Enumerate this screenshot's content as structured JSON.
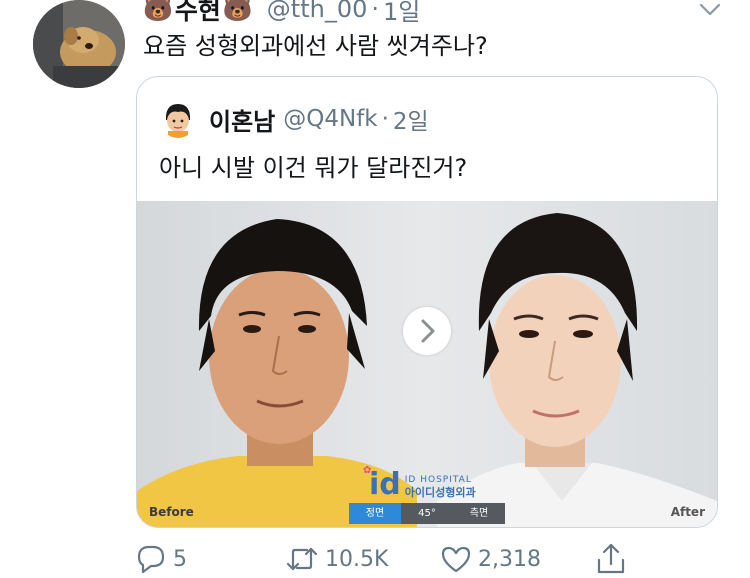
{
  "tweet": {
    "emoji_left": "🐻",
    "display_name": "수현",
    "emoji_right": "🐻",
    "handle": "@tth_00",
    "separator": "·",
    "time": "1일",
    "text": "요즘 성형외과에선 사람 씻겨주나?"
  },
  "quoted_tweet": {
    "display_name": "이혼남",
    "handle": "@Q4Nfk",
    "separator": "·",
    "time": "2일",
    "text": "아니 시발 이건 뭐가 달라진거?",
    "image": {
      "label_before": "Before",
      "label_after": "After",
      "hospital_logo": "id",
      "hospital_name_en": "ID HOSPITAL",
      "hospital_name_ko": "아이디성형외과",
      "view_tabs": [
        "정면",
        "45°",
        "측면"
      ],
      "active_view_tab": "정면"
    }
  },
  "actions": {
    "reply_count": "5",
    "retweet_count": "10.5K",
    "like_count": "2,318"
  },
  "colors": {
    "text_primary": "#14171a",
    "text_secondary": "#657786",
    "border": "#ccd6dd",
    "hospital_blue": "#3b6fb6",
    "active_tab": "#2e8ad8"
  },
  "icons": [
    "caret-down-icon",
    "reply-icon",
    "retweet-icon",
    "like-icon",
    "share-icon",
    "chevron-right-icon"
  ]
}
